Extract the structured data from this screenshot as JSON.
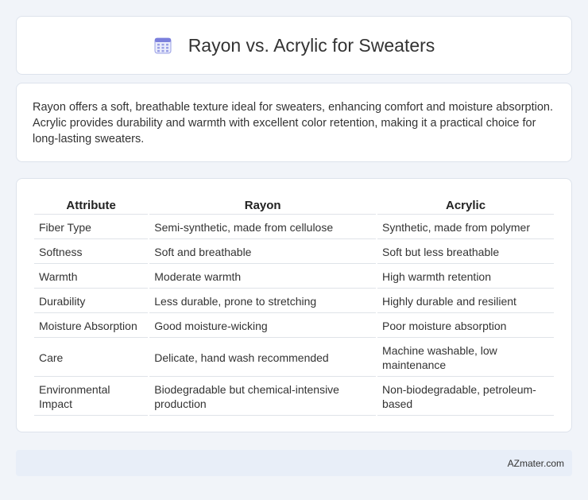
{
  "header": {
    "title": "Rayon vs. Acrylic for Sweaters",
    "icon": "calendar-icon",
    "icon_color": "#7b7fdc"
  },
  "summary": "Rayon offers a soft, breathable texture ideal for sweaters, enhancing comfort and moisture absorption. Acrylic provides durability and warmth with excellent color retention, making it a practical choice for long-lasting sweaters.",
  "table": {
    "headers": [
      "Attribute",
      "Rayon",
      "Acrylic"
    ],
    "rows": [
      [
        "Fiber Type",
        "Semi-synthetic, made from cellulose",
        "Synthetic, made from polymer"
      ],
      [
        "Softness",
        "Soft and breathable",
        "Soft but less breathable"
      ],
      [
        "Warmth",
        "Moderate warmth",
        "High warmth retention"
      ],
      [
        "Durability",
        "Less durable, prone to stretching",
        "Highly durable and resilient"
      ],
      [
        "Moisture Absorption",
        "Good moisture-wicking",
        "Poor moisture absorption"
      ],
      [
        "Care",
        "Delicate, hand wash recommended",
        "Machine washable, low maintenance"
      ],
      [
        "Environmental Impact",
        "Biodegradable but chemical-intensive production",
        "Non-biodegradable, petroleum-based"
      ]
    ]
  },
  "footer": {
    "brand": "AZmater.com"
  }
}
